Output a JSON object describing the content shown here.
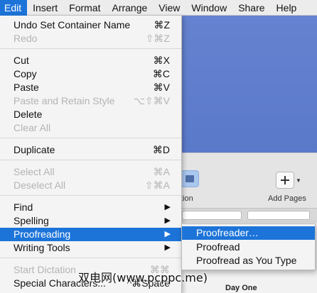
{
  "menubar": {
    "items": [
      "Edit",
      "Insert",
      "Format",
      "Arrange",
      "View",
      "Window",
      "Share",
      "Help"
    ]
  },
  "toolbar": {
    "tool_partial_label": "tion",
    "add_pages_label": "Add Pages",
    "add_pages_icon": "plus-icon"
  },
  "document": {
    "heading_partial": "Day One"
  },
  "edit_menu": {
    "undo": {
      "label": "Undo Set Container Name",
      "shortcut": "⌘Z"
    },
    "redo": {
      "label": "Redo",
      "shortcut": "⇧⌘Z"
    },
    "cut": {
      "label": "Cut",
      "shortcut": "⌘X"
    },
    "copy": {
      "label": "Copy",
      "shortcut": "⌘C"
    },
    "paste": {
      "label": "Paste",
      "shortcut": "⌘V"
    },
    "paste_retain": {
      "label": "Paste and Retain Style",
      "shortcut": "⌥⇧⌘V"
    },
    "delete": {
      "label": "Delete"
    },
    "clear_all": {
      "label": "Clear All"
    },
    "duplicate": {
      "label": "Duplicate",
      "shortcut": "⌘D"
    },
    "select_all": {
      "label": "Select All",
      "shortcut": "⌘A"
    },
    "deselect_all": {
      "label": "Deselect All",
      "shortcut": "⇧⌘A"
    },
    "find": {
      "label": "Find"
    },
    "spelling": {
      "label": "Spelling"
    },
    "proofreading": {
      "label": "Proofreading"
    },
    "writing_tools": {
      "label": "Writing Tools"
    },
    "start_dictation": {
      "label": "Start Dictation",
      "shortcut": "⌘⌘"
    },
    "special_characters": {
      "label": "Special Characters...",
      "shortcut": "^⌘Space"
    }
  },
  "proofreading_submenu": {
    "items": [
      "Proofreader…",
      "Proofread",
      "Proofread as You Type"
    ]
  },
  "watermark": "双电网(www.pcppc.me)",
  "colors": {
    "accent": "#1c74d9",
    "document_background": "#5f7fcd"
  }
}
